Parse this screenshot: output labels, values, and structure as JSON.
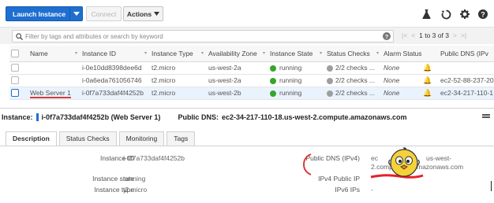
{
  "toolbar": {
    "launch_label": "Launch Instance",
    "connect_label": "Connect",
    "actions_label": "Actions",
    "icons": [
      "flask-icon",
      "refresh-icon",
      "gear-icon",
      "help-icon"
    ]
  },
  "search": {
    "placeholder": "Filter by tags and attributes or search by keyword",
    "pager_text": "1 to 3 of 3"
  },
  "table": {
    "columns": [
      "Name",
      "Instance ID",
      "Instance Type",
      "Availability Zone",
      "Instance State",
      "Status Checks",
      "Alarm Status",
      "Public DNS (IPv"
    ],
    "rows": [
      {
        "name": "",
        "id": "i-0e10dd8398dee6d",
        "type": "t2.micro",
        "az": "us-west-2a",
        "state": "running",
        "checks": "2/2 checks ...",
        "alarm": "None",
        "dns": ""
      },
      {
        "name": "",
        "id": "i-0a6eda761056746",
        "type": "t2.micro",
        "az": "us-west-2a",
        "state": "running",
        "checks": "2/2 checks ...",
        "alarm": "None",
        "dns": "ec2-52-88-237-20"
      },
      {
        "name": "Web Server 1",
        "id": "i-0f7a733daf4f4252b",
        "type": "t2.micro",
        "az": "us-west-2b",
        "state": "running",
        "checks": "2/2 checks ...",
        "alarm": "None",
        "dns": "ec2-34-217-110-1"
      }
    ],
    "state_color": "#37a52b"
  },
  "details": {
    "instance_label": "Instance:",
    "instance_value": "i-0f7a733daf4f4252b (Web Server 1)",
    "dns_label": "Public DNS:",
    "dns_value": "ec2-34-217-110-18.us-west-2.compute.amazonaws.com",
    "tabs": [
      "Description",
      "Status Checks",
      "Monitoring",
      "Tags"
    ],
    "fields": {
      "instance_id_label": "Instance ID",
      "instance_id_value": "i-0f7a733daf4f4252b",
      "instance_state_label": "Instance state",
      "instance_state_value": "running",
      "instance_type_label": "Instance type",
      "instance_type_value": "t2.micro",
      "public_dns_label": "Public DNS (IPv4)",
      "public_dns_value_1": "ec",
      "public_dns_value_2": "us-west-",
      "public_dns_value_3": "2.compu",
      "public_dns_value_4": "mazonaws.com",
      "ipv4_label": "IPv4 Public IP",
      "ipv6_label": "IPv6 IPs",
      "ipv6_value": "-"
    }
  },
  "colors": {
    "primary": "#1f6fd1",
    "annotation": "#d53c3c",
    "cartoon": "#f5d23a"
  }
}
